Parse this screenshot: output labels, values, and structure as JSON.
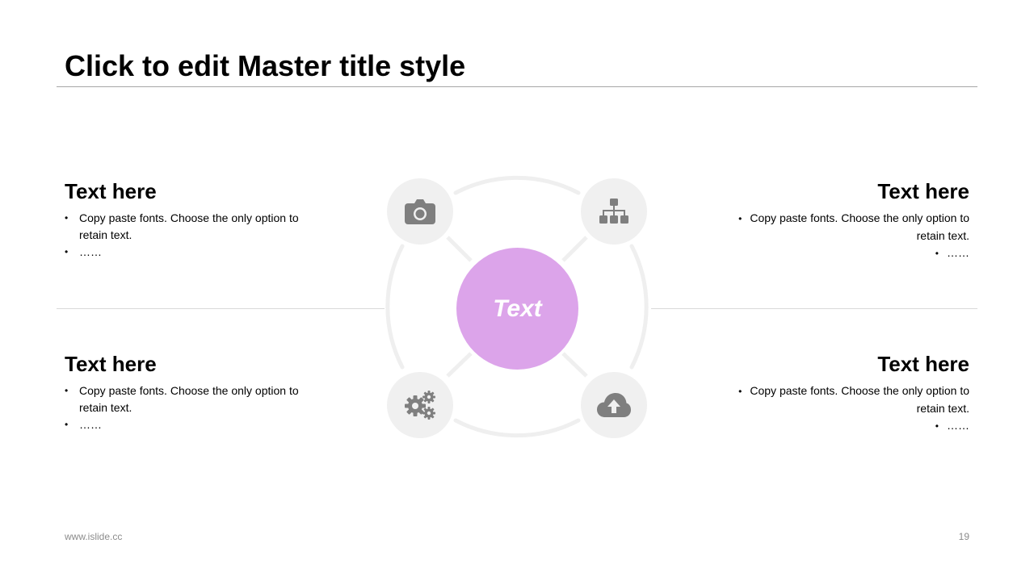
{
  "slide": {
    "title": "Click to edit Master title style",
    "center_label": "Text",
    "footer": {
      "website": "www.islide.cc",
      "page_number": "19"
    }
  },
  "blocks": {
    "top_left": {
      "heading": "Text here",
      "bullets": [
        "Copy paste fonts. Choose the only option to retain text.",
        "……"
      ]
    },
    "top_right": {
      "heading": "Text here",
      "bullets": [
        "Copy paste fonts. Choose the only option to retain text.",
        "……"
      ]
    },
    "bottom_left": {
      "heading": "Text here",
      "bullets": [
        "Copy paste fonts. Choose the only option to retain text.",
        "……"
      ]
    },
    "bottom_right": {
      "heading": "Text here",
      "bullets": [
        "Copy paste fonts. Choose the only option to retain text.",
        "……"
      ]
    }
  },
  "icons": {
    "top_left": "camera-icon",
    "top_right": "hierarchy-icon",
    "bottom_left": "gears-icon",
    "bottom_right": "cloud-upload-icon"
  },
  "colors": {
    "accent": "#dca4ea",
    "icon_gray": "#7f7f7f",
    "node_bg": "#f0f0f0",
    "ring": "#efefef"
  }
}
